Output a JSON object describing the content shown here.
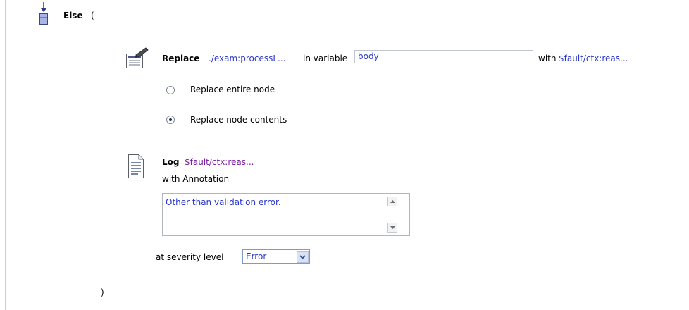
{
  "else_block": {
    "keyword": "Else",
    "open_paren": "(",
    "close_paren": ")"
  },
  "replace_action": {
    "keyword": "Replace",
    "xpath": "./exam:processL...",
    "in_variable_label": "in variable",
    "variable_value": "body",
    "with_label": "with",
    "expression": "$fault/ctx:reas...",
    "options": [
      {
        "label": "Replace entire node",
        "selected": false
      },
      {
        "label": "Replace node contents",
        "selected": true
      }
    ]
  },
  "log_action": {
    "keyword": "Log",
    "expression": "$fault/ctx:reas...",
    "annotation_label": "with Annotation",
    "annotation_text": "Other than validation error.",
    "severity_label": "at severity level",
    "severity_value": "Error"
  },
  "icons": {
    "else": "else-node-icon",
    "replace": "replace-action-icon",
    "log": "log-action-icon"
  }
}
